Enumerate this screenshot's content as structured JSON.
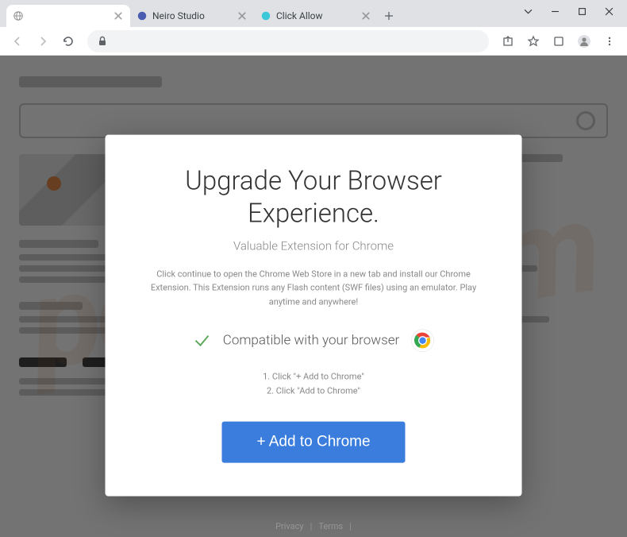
{
  "tabs": [
    {
      "title": "",
      "icon": "globe"
    },
    {
      "title": "Neiro Studio",
      "icon": "neiro"
    },
    {
      "title": "Click Allow",
      "icon": "edge"
    }
  ],
  "modal": {
    "title": "Upgrade Your Browser Experience.",
    "subtitle": "Valuable Extension for Chrome",
    "description": "Click continue to open the Chrome Web Store in a new tab and install our Chrome Extension. This Extension runs any Flash content (SWF files) using an emulator. Play anytime and anywhere!",
    "compatible_text": "Compatible with your browser",
    "step1": "1. Click \"+ Add to Chrome\"",
    "step2": "2. Click \"Add to Chrome\"",
    "cta": "+ Add to Chrome"
  },
  "footer": {
    "privacy": "Privacy",
    "terms": "Terms"
  },
  "watermark": "pcrisk.com"
}
